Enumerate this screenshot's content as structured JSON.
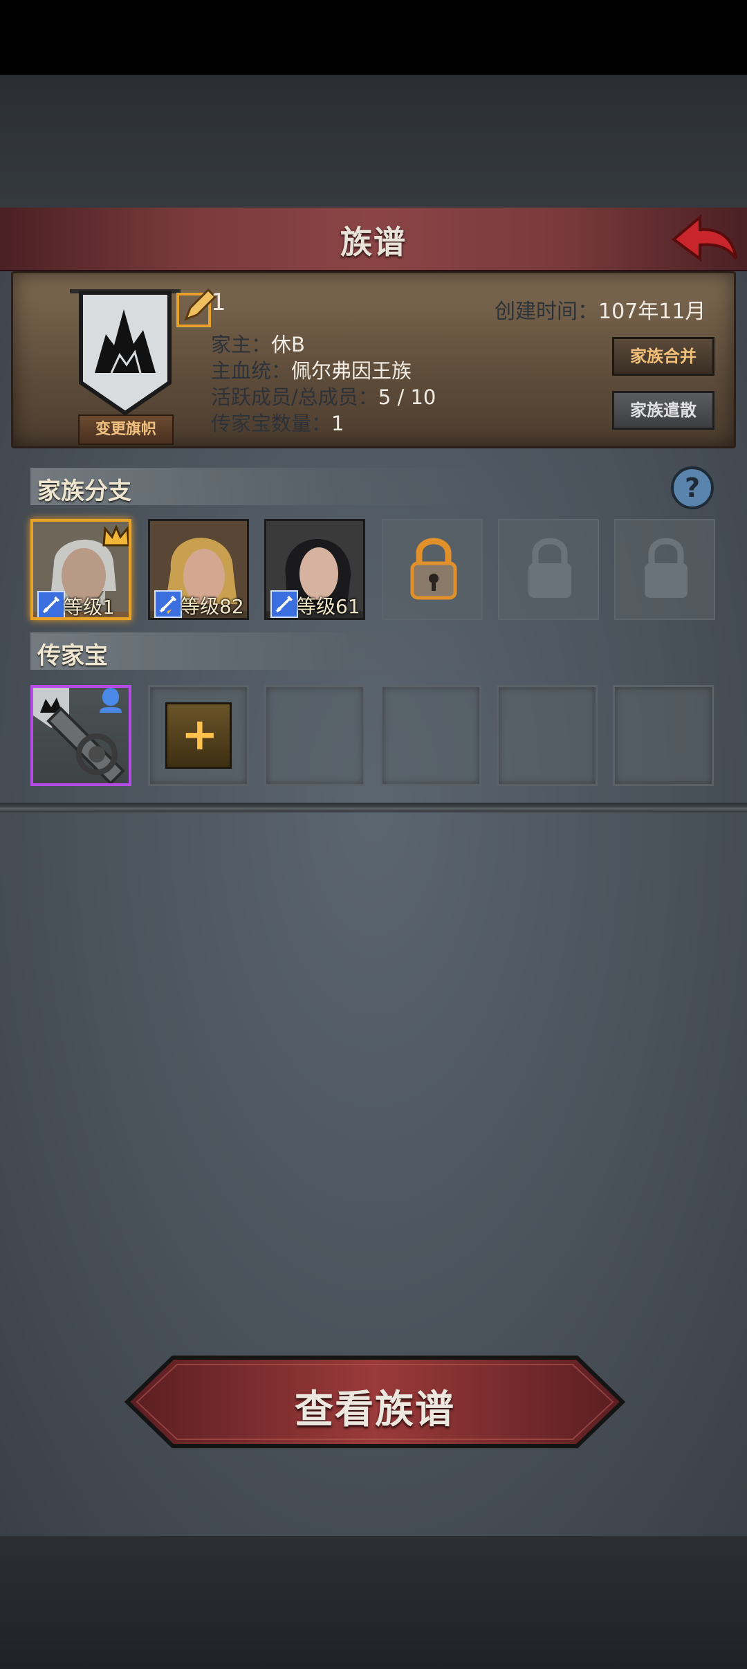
{
  "header": {
    "title": "族谱"
  },
  "family": {
    "count": "1",
    "head_label": "家主：",
    "head_value": "休B",
    "bloodline_label": "主血统：",
    "bloodline_value": "佩尔弗因王族",
    "members_label": "活跃成员/总成员：",
    "members_value": "5 / 10",
    "heirloom_count_label": "传家宝数量：",
    "heirloom_count_value": "1",
    "created_label": "创建时间：",
    "created_value": "107年11月",
    "change_banner_label": "变更旗帜",
    "merge_label": "家族合并",
    "disband_label": "家族遣散"
  },
  "branches": {
    "title": "家族分支",
    "members": [
      {
        "level": "等级1",
        "leader": true
      },
      {
        "level": "等级82",
        "leader": false
      },
      {
        "level": "等级61",
        "leader": false
      }
    ]
  },
  "heirlooms": {
    "title": "传家宝"
  },
  "actions": {
    "view_tree": "查看族谱"
  },
  "colors": {
    "title_bar": "#7a3a3c",
    "leader_border": "#e8a22a",
    "heirloom_border": "#b54ce6",
    "accent_gold": "#f3c07a"
  }
}
